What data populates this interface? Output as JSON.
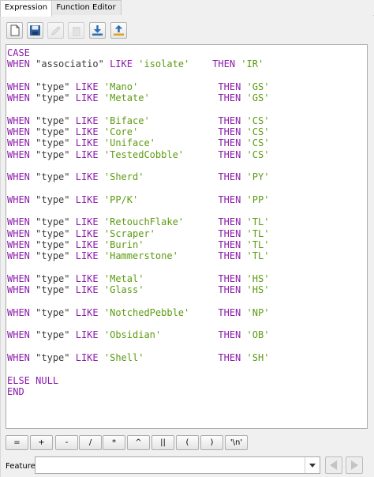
{
  "tabs": [
    {
      "label": "Expression",
      "active": true
    },
    {
      "label": "Function Editor",
      "active": false
    }
  ],
  "toolbar": [
    {
      "icon": "new-file-icon",
      "enabled": true
    },
    {
      "icon": "save-icon",
      "enabled": true
    },
    {
      "icon": "edit-icon",
      "enabled": false
    },
    {
      "icon": "delete-icon",
      "enabled": false
    },
    {
      "icon": "import-icon",
      "enabled": true
    },
    {
      "icon": "export-icon",
      "enabled": true
    }
  ],
  "editor": {
    "lines": [
      [
        {
          "t": "kw",
          "v": "CASE"
        }
      ],
      [
        {
          "t": "kw",
          "v": "WHEN"
        },
        {
          "t": "p",
          "v": " "
        },
        {
          "t": "fld",
          "v": "\"associatio\""
        },
        {
          "t": "p",
          "v": " "
        },
        {
          "t": "kw",
          "v": "LIKE"
        },
        {
          "t": "p",
          "v": " "
        },
        {
          "t": "str",
          "v": "'isolate'"
        },
        {
          "t": "p",
          "v": "    "
        },
        {
          "t": "kw",
          "v": "THEN"
        },
        {
          "t": "p",
          "v": " "
        },
        {
          "t": "str",
          "v": "'IR'"
        }
      ],
      [],
      [
        {
          "t": "kw",
          "v": "WHEN"
        },
        {
          "t": "p",
          "v": " "
        },
        {
          "t": "fld",
          "v": "\"type\""
        },
        {
          "t": "p",
          "v": " "
        },
        {
          "t": "kw",
          "v": "LIKE"
        },
        {
          "t": "p",
          "v": " "
        },
        {
          "t": "str",
          "v": "'Mano'"
        },
        {
          "t": "p",
          "v": "              "
        },
        {
          "t": "kw",
          "v": "THEN"
        },
        {
          "t": "p",
          "v": " "
        },
        {
          "t": "str",
          "v": "'GS'"
        }
      ],
      [
        {
          "t": "kw",
          "v": "WHEN"
        },
        {
          "t": "p",
          "v": " "
        },
        {
          "t": "fld",
          "v": "\"type\""
        },
        {
          "t": "p",
          "v": " "
        },
        {
          "t": "kw",
          "v": "LIKE"
        },
        {
          "t": "p",
          "v": " "
        },
        {
          "t": "str",
          "v": "'Metate'"
        },
        {
          "t": "p",
          "v": "            "
        },
        {
          "t": "kw",
          "v": "THEN"
        },
        {
          "t": "p",
          "v": " "
        },
        {
          "t": "str",
          "v": "'GS'"
        }
      ],
      [],
      [
        {
          "t": "kw",
          "v": "WHEN"
        },
        {
          "t": "p",
          "v": " "
        },
        {
          "t": "fld",
          "v": "\"type\""
        },
        {
          "t": "p",
          "v": " "
        },
        {
          "t": "kw",
          "v": "LIKE"
        },
        {
          "t": "p",
          "v": " "
        },
        {
          "t": "str",
          "v": "'Biface'"
        },
        {
          "t": "p",
          "v": "            "
        },
        {
          "t": "kw",
          "v": "THEN"
        },
        {
          "t": "p",
          "v": " "
        },
        {
          "t": "str",
          "v": "'CS'"
        }
      ],
      [
        {
          "t": "kw",
          "v": "WHEN"
        },
        {
          "t": "p",
          "v": " "
        },
        {
          "t": "fld",
          "v": "\"type\""
        },
        {
          "t": "p",
          "v": " "
        },
        {
          "t": "kw",
          "v": "LIKE"
        },
        {
          "t": "p",
          "v": " "
        },
        {
          "t": "str",
          "v": "'Core'"
        },
        {
          "t": "p",
          "v": "              "
        },
        {
          "t": "kw",
          "v": "THEN"
        },
        {
          "t": "p",
          "v": " "
        },
        {
          "t": "str",
          "v": "'CS'"
        }
      ],
      [
        {
          "t": "kw",
          "v": "WHEN"
        },
        {
          "t": "p",
          "v": " "
        },
        {
          "t": "fld",
          "v": "\"type\""
        },
        {
          "t": "p",
          "v": " "
        },
        {
          "t": "kw",
          "v": "LIKE"
        },
        {
          "t": "p",
          "v": " "
        },
        {
          "t": "str",
          "v": "'Uniface'"
        },
        {
          "t": "p",
          "v": "           "
        },
        {
          "t": "kw",
          "v": "THEN"
        },
        {
          "t": "p",
          "v": " "
        },
        {
          "t": "str",
          "v": "'CS'"
        }
      ],
      [
        {
          "t": "kw",
          "v": "WHEN"
        },
        {
          "t": "p",
          "v": " "
        },
        {
          "t": "fld",
          "v": "\"type\""
        },
        {
          "t": "p",
          "v": " "
        },
        {
          "t": "kw",
          "v": "LIKE"
        },
        {
          "t": "p",
          "v": " "
        },
        {
          "t": "str",
          "v": "'TestedCobble'"
        },
        {
          "t": "p",
          "v": "      "
        },
        {
          "t": "kw",
          "v": "THEN"
        },
        {
          "t": "p",
          "v": " "
        },
        {
          "t": "str",
          "v": "'CS'"
        }
      ],
      [],
      [
        {
          "t": "kw",
          "v": "WHEN"
        },
        {
          "t": "p",
          "v": " "
        },
        {
          "t": "fld",
          "v": "\"type\""
        },
        {
          "t": "p",
          "v": " "
        },
        {
          "t": "kw",
          "v": "LIKE"
        },
        {
          "t": "p",
          "v": " "
        },
        {
          "t": "str",
          "v": "'Sherd'"
        },
        {
          "t": "p",
          "v": "             "
        },
        {
          "t": "kw",
          "v": "THEN"
        },
        {
          "t": "p",
          "v": " "
        },
        {
          "t": "str",
          "v": "'PY'"
        }
      ],
      [],
      [
        {
          "t": "kw",
          "v": "WHEN"
        },
        {
          "t": "p",
          "v": " "
        },
        {
          "t": "fld",
          "v": "\"type\""
        },
        {
          "t": "p",
          "v": " "
        },
        {
          "t": "kw",
          "v": "LIKE"
        },
        {
          "t": "p",
          "v": " "
        },
        {
          "t": "str",
          "v": "'PP/K'"
        },
        {
          "t": "p",
          "v": "              "
        },
        {
          "t": "kw",
          "v": "THEN"
        },
        {
          "t": "p",
          "v": " "
        },
        {
          "t": "str",
          "v": "'PP'"
        }
      ],
      [],
      [
        {
          "t": "kw",
          "v": "WHEN"
        },
        {
          "t": "p",
          "v": " "
        },
        {
          "t": "fld",
          "v": "\"type\""
        },
        {
          "t": "p",
          "v": " "
        },
        {
          "t": "kw",
          "v": "LIKE"
        },
        {
          "t": "p",
          "v": " "
        },
        {
          "t": "str",
          "v": "'RetouchFlake'"
        },
        {
          "t": "p",
          "v": "      "
        },
        {
          "t": "kw",
          "v": "THEN"
        },
        {
          "t": "p",
          "v": " "
        },
        {
          "t": "str",
          "v": "'TL'"
        }
      ],
      [
        {
          "t": "kw",
          "v": "WHEN"
        },
        {
          "t": "p",
          "v": " "
        },
        {
          "t": "fld",
          "v": "\"type\""
        },
        {
          "t": "p",
          "v": " "
        },
        {
          "t": "kw",
          "v": "LIKE"
        },
        {
          "t": "p",
          "v": " "
        },
        {
          "t": "str",
          "v": "'Scraper'"
        },
        {
          "t": "p",
          "v": "           "
        },
        {
          "t": "kw",
          "v": "THEN"
        },
        {
          "t": "p",
          "v": " "
        },
        {
          "t": "str",
          "v": "'TL'"
        }
      ],
      [
        {
          "t": "kw",
          "v": "WHEN"
        },
        {
          "t": "p",
          "v": " "
        },
        {
          "t": "fld",
          "v": "\"type\""
        },
        {
          "t": "p",
          "v": " "
        },
        {
          "t": "kw",
          "v": "LIKE"
        },
        {
          "t": "p",
          "v": " "
        },
        {
          "t": "str",
          "v": "'Burin'"
        },
        {
          "t": "p",
          "v": "             "
        },
        {
          "t": "kw",
          "v": "THEN"
        },
        {
          "t": "p",
          "v": " "
        },
        {
          "t": "str",
          "v": "'TL'"
        }
      ],
      [
        {
          "t": "kw",
          "v": "WHEN"
        },
        {
          "t": "p",
          "v": " "
        },
        {
          "t": "fld",
          "v": "\"type\""
        },
        {
          "t": "p",
          "v": " "
        },
        {
          "t": "kw",
          "v": "LIKE"
        },
        {
          "t": "p",
          "v": " "
        },
        {
          "t": "str",
          "v": "'Hammerstone'"
        },
        {
          "t": "p",
          "v": "       "
        },
        {
          "t": "kw",
          "v": "THEN"
        },
        {
          "t": "p",
          "v": " "
        },
        {
          "t": "str",
          "v": "'TL'"
        }
      ],
      [],
      [
        {
          "t": "kw",
          "v": "WHEN"
        },
        {
          "t": "p",
          "v": " "
        },
        {
          "t": "fld",
          "v": "\"type\""
        },
        {
          "t": "p",
          "v": " "
        },
        {
          "t": "kw",
          "v": "LIKE"
        },
        {
          "t": "p",
          "v": " "
        },
        {
          "t": "str",
          "v": "'Metal'"
        },
        {
          "t": "p",
          "v": "             "
        },
        {
          "t": "kw",
          "v": "THEN"
        },
        {
          "t": "p",
          "v": " "
        },
        {
          "t": "str",
          "v": "'HS'"
        }
      ],
      [
        {
          "t": "kw",
          "v": "WHEN"
        },
        {
          "t": "p",
          "v": " "
        },
        {
          "t": "fld",
          "v": "\"type\""
        },
        {
          "t": "p",
          "v": " "
        },
        {
          "t": "kw",
          "v": "LIKE"
        },
        {
          "t": "p",
          "v": " "
        },
        {
          "t": "str",
          "v": "'Glass'"
        },
        {
          "t": "p",
          "v": "             "
        },
        {
          "t": "kw",
          "v": "THEN"
        },
        {
          "t": "p",
          "v": " "
        },
        {
          "t": "str",
          "v": "'HS'"
        }
      ],
      [],
      [
        {
          "t": "kw",
          "v": "WHEN"
        },
        {
          "t": "p",
          "v": " "
        },
        {
          "t": "fld",
          "v": "\"type\""
        },
        {
          "t": "p",
          "v": " "
        },
        {
          "t": "kw",
          "v": "LIKE"
        },
        {
          "t": "p",
          "v": " "
        },
        {
          "t": "str",
          "v": "'NotchedPebble'"
        },
        {
          "t": "p",
          "v": "     "
        },
        {
          "t": "kw",
          "v": "THEN"
        },
        {
          "t": "p",
          "v": " "
        },
        {
          "t": "str",
          "v": "'NP'"
        }
      ],
      [],
      [
        {
          "t": "kw",
          "v": "WHEN"
        },
        {
          "t": "p",
          "v": " "
        },
        {
          "t": "fld",
          "v": "\"type\""
        },
        {
          "t": "p",
          "v": " "
        },
        {
          "t": "kw",
          "v": "LIKE"
        },
        {
          "t": "p",
          "v": " "
        },
        {
          "t": "str",
          "v": "'Obsidian'"
        },
        {
          "t": "p",
          "v": "          "
        },
        {
          "t": "kw",
          "v": "THEN"
        },
        {
          "t": "p",
          "v": " "
        },
        {
          "t": "str",
          "v": "'OB'"
        }
      ],
      [],
      [
        {
          "t": "kw",
          "v": "WHEN"
        },
        {
          "t": "p",
          "v": " "
        },
        {
          "t": "fld",
          "v": "\"type\""
        },
        {
          "t": "p",
          "v": " "
        },
        {
          "t": "kw",
          "v": "LIKE"
        },
        {
          "t": "p",
          "v": " "
        },
        {
          "t": "str",
          "v": "'Shell'"
        },
        {
          "t": "p",
          "v": "             "
        },
        {
          "t": "kw",
          "v": "THEN"
        },
        {
          "t": "p",
          "v": " "
        },
        {
          "t": "str",
          "v": "'SH'"
        }
      ],
      [],
      [
        {
          "t": "kw",
          "v": "ELSE"
        },
        {
          "t": "p",
          "v": " "
        },
        {
          "t": "kw",
          "v": "NULL"
        }
      ],
      [
        {
          "t": "kw",
          "v": "END"
        }
      ]
    ]
  },
  "operators": [
    "=",
    "+",
    "-",
    "/",
    "*",
    "^",
    "||",
    "(",
    ")",
    "'\\n'"
  ],
  "feature": {
    "label": "Feature",
    "value": ""
  },
  "colors": {
    "keyword": "#8c1cab",
    "string": "#5c9b11",
    "field": "#3a3a3a"
  }
}
